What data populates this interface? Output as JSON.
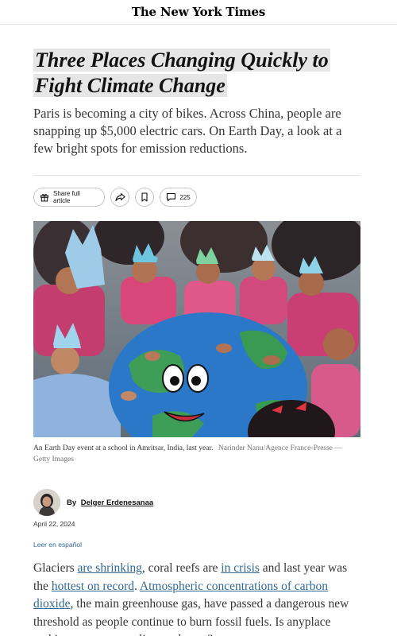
{
  "masthead": {
    "title": "The New York Times"
  },
  "article": {
    "headline_line1": "Three Places Changing Quickly to",
    "headline_line2": "Fight Climate Change",
    "dek": "Paris is becoming a city of bikes. Across China, people are snapping up $5,000 electric cars. On Earth Day, a look at a few bright spots for emission reductions."
  },
  "actions": {
    "share_label": "Share full article",
    "share_icon": "gift-icon",
    "forward_icon": "share-arrow-icon",
    "save_icon": "bookmark-icon",
    "comments_icon": "comment-icon",
    "comment_count": "225"
  },
  "photo": {
    "alt": "",
    "caption": "An Earth Day event at a school in Amritsar, India, last year.",
    "credit": "Narinder Nanu/Agence France-Presse — Getty Images"
  },
  "byline": {
    "prefix": "By",
    "author": "Delger Erdenesanaa",
    "date": "April 22, 2024",
    "language_link": "Leer en español"
  },
  "body": {
    "t1": "Glaciers ",
    "l1": "are shrinking",
    "t2": ", coral reefs are ",
    "l2": "in crisis",
    "t3": " and last year was the ",
    "l3": "hottest on record",
    "t4": ". ",
    "l4": "Atmospheric concentrations of carbon dioxide",
    "t5": ", the main greenhouse gas, have passed a dangerous new threshold as people continue to burn fossil fuels. Is anyplace making progress on climate change?"
  },
  "colors": {
    "link": "#326891",
    "text": "#121212",
    "divider": "#e2e2e2"
  }
}
